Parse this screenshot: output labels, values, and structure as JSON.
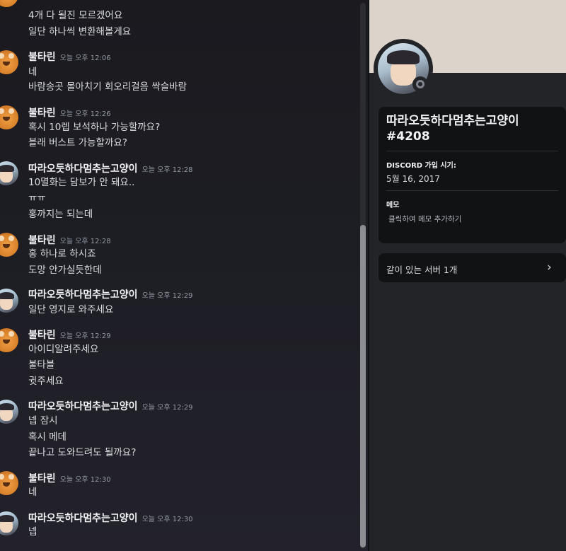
{
  "chat": {
    "top_line_1": "4개 다 될진 모르겠어요",
    "top_line_2": "일단 하나씩 변환해볼게요",
    "messages": [
      {
        "author": "불타린",
        "time": "오늘 오후 12:06",
        "lines": [
          "네",
          "바람송곳 몰아치기 회오리걸음 싹슬바람"
        ]
      },
      {
        "author": "불타린",
        "time": "오늘 오후 12:26",
        "lines": [
          "혹시 10렙 보석하나 가능할까요?",
          "블래 버스트 가능할까요?"
        ]
      },
      {
        "author": "따라오듯하다멈추는고양이",
        "time": "오늘 오후 12:28",
        "lines": [
          "10멸화는 담보가 안 돼요..",
          "ㅠㅠ",
          "홍까지는 되는데"
        ]
      },
      {
        "author": "불타린",
        "time": "오늘 오후 12:28",
        "lines": [
          "홍 하나로 하시죠",
          "도망 안가실듯한데"
        ]
      },
      {
        "author": "따라오듯하다멈추는고양이",
        "time": "오늘 오후 12:29",
        "lines": [
          "일단 영지로 와주세요"
        ]
      },
      {
        "author": "불타린",
        "time": "오늘 오후 12:29",
        "lines": [
          "아이디알려주세요",
          "불타블",
          "귓주세요"
        ]
      },
      {
        "author": "따라오듯하다멈추는고양이",
        "time": "오늘 오후 12:29",
        "lines": [
          "넵 잠시",
          "혹시 메데",
          "끝나고 도와드려도 될까요?"
        ]
      },
      {
        "author": "불타린",
        "time": "오늘 오후 12:30",
        "lines": [
          "네"
        ]
      },
      {
        "author": "따라오듯하다멈추는고양이",
        "time": "오늘 오후 12:30",
        "lines": [
          "넵"
        ]
      }
    ]
  },
  "profile": {
    "display_name": "따라오듯하다멈추는고양이",
    "tag": "#4208",
    "join_title": "DISCORD 가입 시기:",
    "join_date": "5월 16, 2017",
    "note_title": "메모",
    "note_placeholder": "클릭하여 메모 추가하기",
    "mutual_servers": "같이 있는 서버 1개",
    "status": "offline",
    "banner_color": "#dcd3cb"
  }
}
